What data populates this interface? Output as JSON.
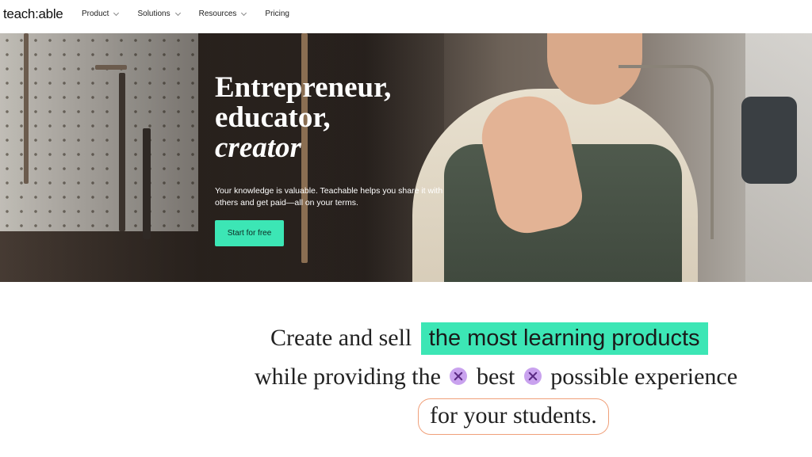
{
  "nav": {
    "logo": "teach:able",
    "items": [
      {
        "label": "Product",
        "has_dropdown": true
      },
      {
        "label": "Solutions",
        "has_dropdown": true
      },
      {
        "label": "Resources",
        "has_dropdown": true
      },
      {
        "label": "Pricing",
        "has_dropdown": false
      }
    ]
  },
  "hero": {
    "title_line1": "Entrepreneur,",
    "title_line2": "educator,",
    "title_line3": "creator",
    "subtitle": "Your knowledge is valuable. Teachable helps you share it with others and get paid—all on your terms.",
    "cta_label": "Start for free"
  },
  "statement": {
    "row1_text": "Create and sell",
    "row1_highlight": "the most learning products",
    "row2_part1": "while providing the",
    "row2_part2": "best",
    "row2_part3": "possible experience",
    "row3_text": "for your students."
  },
  "colors": {
    "accent": "#3ce6b5",
    "spark": "#c9a2ee",
    "outline": "#f0a07a"
  }
}
